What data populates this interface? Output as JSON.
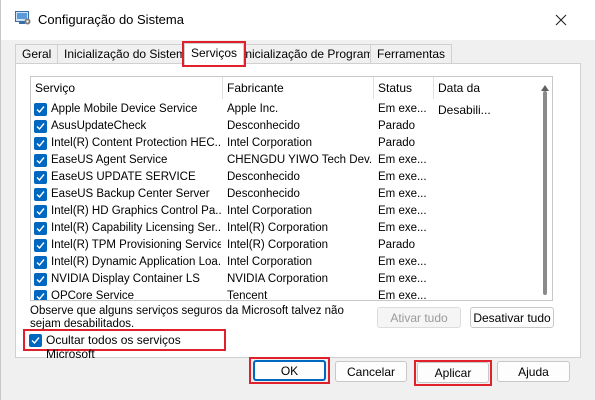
{
  "window": {
    "title": "Configuração do Sistema",
    "close_icon": "close-icon",
    "app_icon": "system-config-icon"
  },
  "tabs": [
    {
      "label": "Geral",
      "active": false
    },
    {
      "label": "Inicialização do Sistema",
      "active": false
    },
    {
      "label": "Serviços",
      "active": true
    },
    {
      "label": "Inicialização de Programas",
      "active": false
    },
    {
      "label": "Ferramentas",
      "active": false
    }
  ],
  "table": {
    "columns": [
      "Serviço",
      "Fabricante",
      "Status",
      "Data da Desabili..."
    ],
    "rows": [
      {
        "service": "Apple Mobile Device Service",
        "manufacturer": "Apple Inc.",
        "status": "Em exe...",
        "date": "",
        "checked": true
      },
      {
        "service": "AsusUpdateCheck",
        "manufacturer": "Desconhecido",
        "status": "Parado",
        "date": "",
        "checked": true
      },
      {
        "service": "Intel(R) Content Protection HEC...",
        "manufacturer": "Intel Corporation",
        "status": "Parado",
        "date": "",
        "checked": true
      },
      {
        "service": "EaseUS Agent Service",
        "manufacturer": "CHENGDU YIWO Tech Dev...",
        "status": "Em exe...",
        "date": "",
        "checked": true
      },
      {
        "service": "EaseUS UPDATE SERVICE",
        "manufacturer": "Desconhecido",
        "status": "Em exe...",
        "date": "",
        "checked": true
      },
      {
        "service": "EaseUS Backup Center Server",
        "manufacturer": "Desconhecido",
        "status": "Em exe...",
        "date": "",
        "checked": true
      },
      {
        "service": "Intel(R) HD Graphics Control Pa...",
        "manufacturer": "Intel Corporation",
        "status": "Em exe...",
        "date": "",
        "checked": true
      },
      {
        "service": "Intel(R) Capability Licensing Ser...",
        "manufacturer": "Intel(R) Corporation",
        "status": "Em exe...",
        "date": "",
        "checked": true
      },
      {
        "service": "Intel(R) TPM Provisioning Service",
        "manufacturer": "Intel(R) Corporation",
        "status": "Parado",
        "date": "",
        "checked": true
      },
      {
        "service": "Intel(R) Dynamic Application Loa...",
        "manufacturer": "Intel Corporation",
        "status": "Em exe...",
        "date": "",
        "checked": true
      },
      {
        "service": "NVIDIA Display Container LS",
        "manufacturer": "NVIDIA Corporation",
        "status": "Em exe...",
        "date": "",
        "checked": true
      },
      {
        "service": "OPCore Service",
        "manufacturer": "Tencent",
        "status": "Em exe...",
        "date": "",
        "checked": true
      }
    ]
  },
  "note": "Observe que alguns serviços seguros da Microsoft talvez não sejam desabilitados.",
  "buttons": {
    "enable_all": "Ativar tudo",
    "disable_all": "Desativar tudo",
    "ok": "OK",
    "cancel": "Cancelar",
    "apply": "Aplicar",
    "help": "Ajuda"
  },
  "hide_ms": {
    "label": "Ocultar todos os serviços Microsoft",
    "checked": true
  },
  "colors": {
    "accent": "#0067c0",
    "highlight": "#e0202a"
  }
}
